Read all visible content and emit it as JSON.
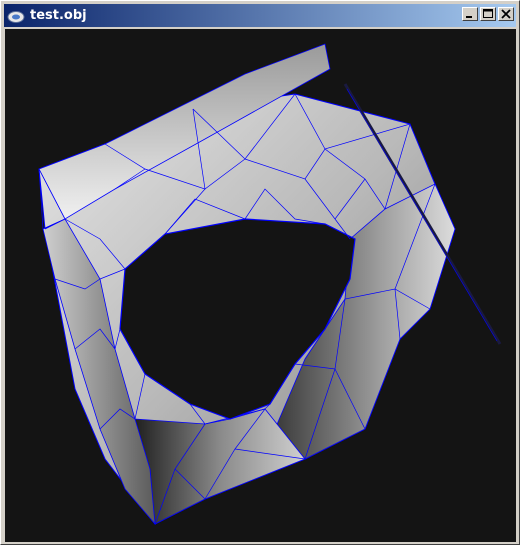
{
  "window": {
    "title": "test.obj",
    "app_icon": "app-window-icon",
    "controls": [
      "minimize-icon",
      "maximize-icon",
      "close-icon"
    ],
    "titlebar_color_start": "#0a246a",
    "titlebar_color_end": "#a6caf0"
  },
  "viewport": {
    "background": "#141414",
    "model_fill": "#d9d9d9",
    "wireframe_color": "#0000ff",
    "render_mode": "shaded-with-wireframe"
  }
}
